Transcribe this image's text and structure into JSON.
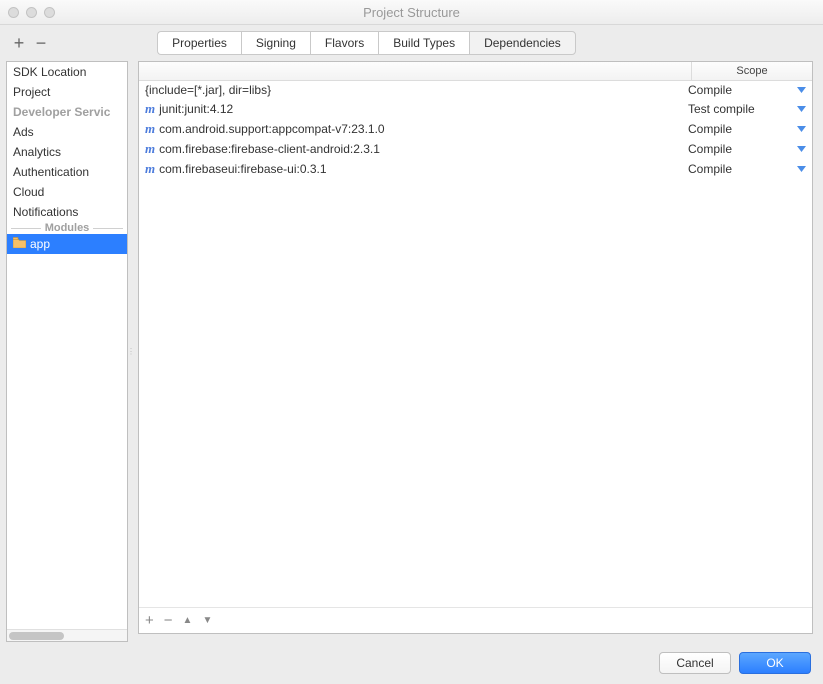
{
  "window": {
    "title": "Project Structure"
  },
  "toolbar": {
    "add": "+",
    "remove": "−"
  },
  "tabs": {
    "items": [
      "Properties",
      "Signing",
      "Flavors",
      "Build Types",
      "Dependencies"
    ],
    "active_index": 4
  },
  "sidebar": {
    "items": [
      {
        "label": "SDK Location",
        "type": "item"
      },
      {
        "label": "Project",
        "type": "item"
      },
      {
        "label": "Developer Servic",
        "type": "section"
      },
      {
        "label": "Ads",
        "type": "item"
      },
      {
        "label": "Analytics",
        "type": "item"
      },
      {
        "label": "Authentication",
        "type": "item"
      },
      {
        "label": "Cloud",
        "type": "item"
      },
      {
        "label": "Notifications",
        "type": "item"
      }
    ],
    "modules_label": "Modules",
    "selected_module": "app"
  },
  "deps": {
    "header_scope": "Scope",
    "rows": [
      {
        "icon": "",
        "label": "{include=[*.jar], dir=libs}",
        "scope": "Compile"
      },
      {
        "icon": "m",
        "label": "junit:junit:4.12",
        "scope": "Test compile"
      },
      {
        "icon": "m",
        "label": "com.android.support:appcompat-v7:23.1.0",
        "scope": "Compile"
      },
      {
        "icon": "m",
        "label": "com.firebase:firebase-client-android:2.3.1",
        "scope": "Compile"
      },
      {
        "icon": "m",
        "label": "com.firebaseui:firebase-ui:0.3.1",
        "scope": "Compile"
      }
    ],
    "footer": {
      "add": "+",
      "remove": "−",
      "up": "▲",
      "down": "▼"
    }
  },
  "buttons": {
    "cancel": "Cancel",
    "ok": "OK"
  }
}
